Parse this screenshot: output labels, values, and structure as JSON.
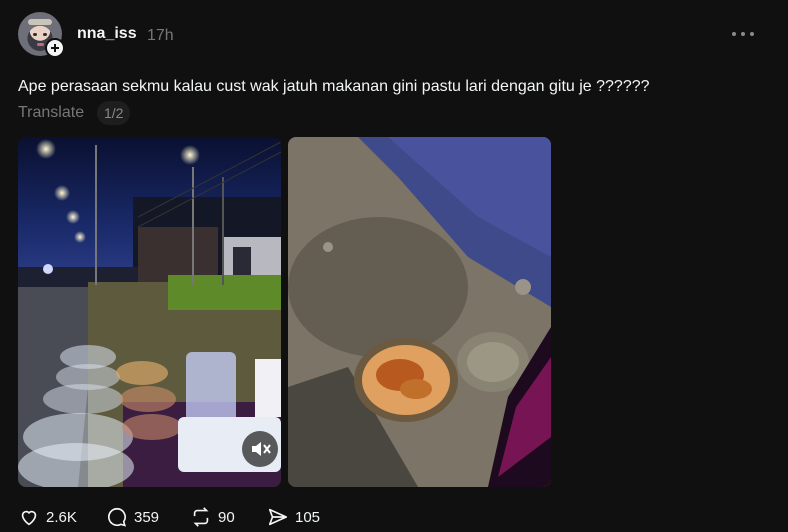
{
  "post": {
    "username": "nna_iss",
    "time": "17h",
    "text": "Ape perasaan sekmu kalau cust wak jatuh makanan gini pastu lari dengan gitu je ??????",
    "translate_label": "Translate",
    "media_counter": "1/2"
  },
  "media": [
    {
      "icon": "video-thumbnail-roadside-food-stall",
      "muted": true
    },
    {
      "icon": "photo-spilled-food-on-ground"
    }
  ],
  "actions": {
    "likes": "2.6K",
    "replies": "359",
    "reposts": "90",
    "shares": "105"
  },
  "colors": {
    "background": "#101010",
    "text_primary": "#f3f5f7",
    "text_secondary": "#777777"
  }
}
